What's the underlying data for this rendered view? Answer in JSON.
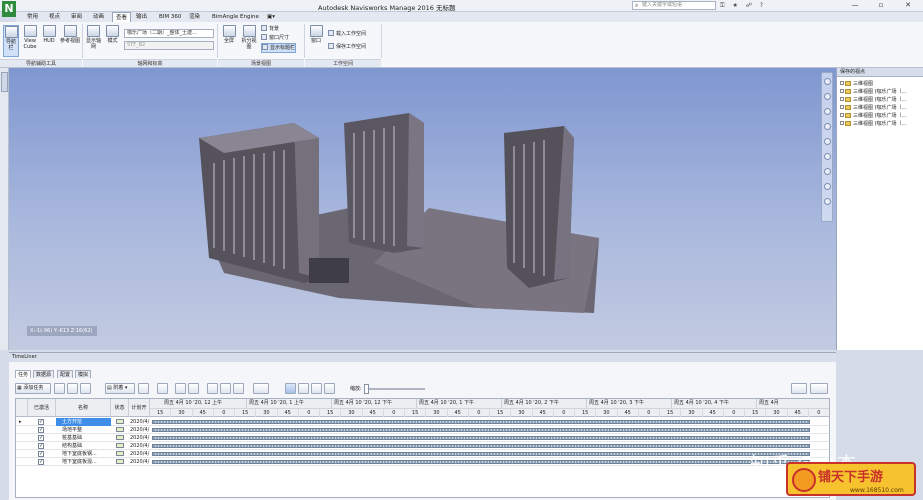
{
  "window": {
    "title": "Autodesk Navisworks Manage 2016    无标题",
    "logo": "N",
    "search_placeholder": "键入关键字或短语",
    "controls": [
      "—",
      "▫",
      "✕"
    ]
  },
  "menu_tabs": [
    {
      "label": "常用",
      "active": false
    },
    {
      "label": "视点",
      "active": false
    },
    {
      "label": "审阅",
      "active": false
    },
    {
      "label": "动画",
      "active": false
    },
    {
      "label": "查看",
      "active": true
    },
    {
      "label": "输出",
      "active": false
    },
    {
      "label": "BIM 360",
      "active": false
    },
    {
      "label": "渲染",
      "active": false
    },
    {
      "label": "BimAngle Engine",
      "active": false
    }
  ],
  "ribbon": {
    "nav_aids": {
      "buttons": [
        "导航栏",
        "View Cube",
        "HUD",
        "参考视图"
      ],
      "group_label": "导航辅助工具"
    },
    "grids": {
      "show_axes": "显示轴网",
      "mode": "模式",
      "dropdown_1": "咖乐广场（二期）_整体_土建...",
      "dropdown_2": "5TF_B2",
      "group_label": "轴网和标高"
    },
    "scene": {
      "fullscreen": "全屏",
      "split": "拆分视图",
      "background": "背景",
      "window_size": "窗口尺寸",
      "show_title": "显示标题栏",
      "group_label": "场景视图"
    },
    "workspace": {
      "windows": "窗口",
      "load": "载入工作空间",
      "save": "保存工作空间",
      "group_label": "工作空间"
    }
  },
  "viewport": {
    "coordinates": "X:-1(-96) Y:-613 Z:16(62)"
  },
  "saved_viewpoints": {
    "title": "保存的视点",
    "items": [
      "三维视图",
      "三维视图 (咖乐广场（...",
      "三维视图 (咖乐广场（...",
      "三维视图 (咖乐广场（...",
      "三维视图 (咖乐广场（...",
      "三维视图 (咖乐广场（..."
    ]
  },
  "timeliner": {
    "title": "TimeLiner",
    "tabs": [
      "任务",
      "数据源",
      "配置",
      "模拟"
    ],
    "add_task": "添加任务",
    "attach": "附着",
    "zoom_label": "缩放:",
    "columns": {
      "active": "已激活",
      "name": "名称",
      "status": "状态",
      "planned": "计划开"
    },
    "date_headers": [
      "周五 4月 10 '20, 12 上午",
      "周五 4月 10 '20, 1 上午",
      "周五 4月 10 '20, 12 下午",
      "周五 4月 10 '20, 1 下午",
      "周五 4月 10 '20, 2 下午",
      "周五 4月 10 '20, 3 下午",
      "周五 4月 10 '20, 4 下午",
      "周五 4月"
    ],
    "minute_ticks": [
      "15",
      "30",
      "45",
      "0",
      "15",
      "30",
      "45",
      "0",
      "15",
      "30",
      "45",
      "0",
      "15",
      "30",
      "45",
      "0",
      "15",
      "30",
      "45",
      "0",
      "15",
      "30",
      "45",
      "0",
      "15",
      "30",
      "45",
      "0",
      "15",
      "30",
      "45",
      "0"
    ],
    "rows": [
      {
        "checked": true,
        "name": "土方开挖",
        "planned": "2020/4/",
        "selected": true
      },
      {
        "checked": true,
        "name": "场地平整",
        "planned": "2020/4/",
        "selected": false
      },
      {
        "checked": true,
        "name": "桩基基础",
        "planned": "2020/4/",
        "selected": false
      },
      {
        "checked": true,
        "name": "结构基础",
        "planned": "2020/4/",
        "selected": false
      },
      {
        "checked": true,
        "name": "地下室底板钢...",
        "planned": "2020/4/",
        "selected": false
      },
      {
        "checked": true,
        "name": "地下室底板混...",
        "planned": "2020/4/",
        "selected": false
      }
    ]
  },
  "overlay": {
    "watermark": "知乎 @小杰",
    "badge_title": "铺天下手游",
    "badge_url": "www.168510.com"
  }
}
